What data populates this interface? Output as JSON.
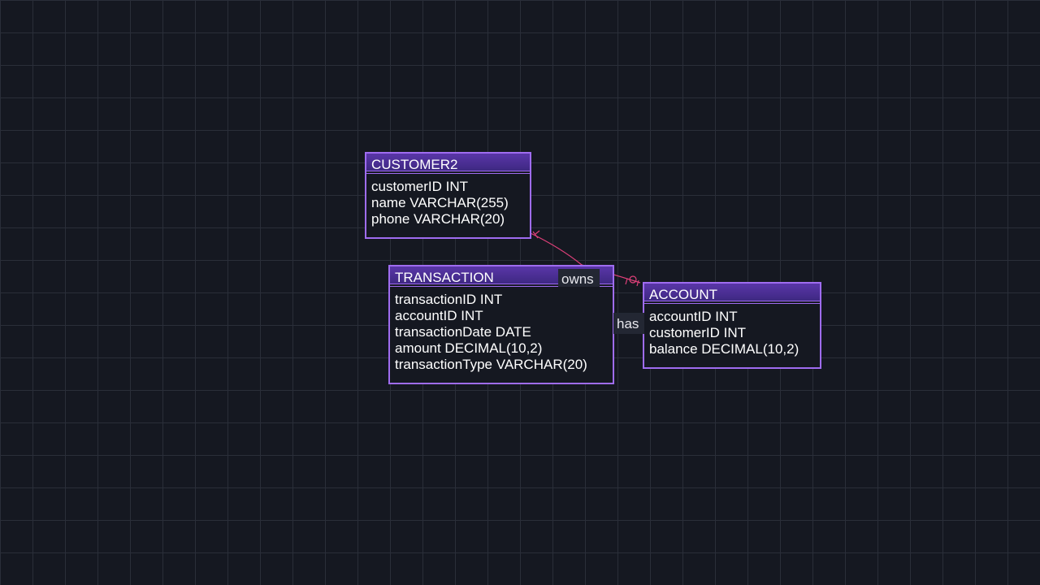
{
  "colors": {
    "background": "#151821",
    "grid": "#2a2e39",
    "entity_border": "#9f6cf0",
    "entity_header": "#4a2e94",
    "relationship_line": "#e0407a",
    "text": "#ffffff"
  },
  "entities": {
    "customer2": {
      "title": "CUSTOMER2",
      "fields": [
        "customerID INT",
        "name VARCHAR(255)",
        "phone VARCHAR(20)"
      ]
    },
    "transaction": {
      "title": "TRANSACTION",
      "fields": [
        "transactionID INT",
        "accountID INT",
        "transactionDate DATE",
        "amount DECIMAL(10,2)",
        "transactionType VARCHAR(20)"
      ]
    },
    "account": {
      "title": "ACCOUNT",
      "fields": [
        "accountID INT",
        "customerID INT",
        "balance DECIMAL(10,2)"
      ]
    }
  },
  "relationships": {
    "owns": {
      "label": "owns",
      "from": "CUSTOMER2",
      "to": "ACCOUNT"
    },
    "has": {
      "label": "has",
      "from": "ACCOUNT",
      "to": "TRANSACTION"
    }
  }
}
